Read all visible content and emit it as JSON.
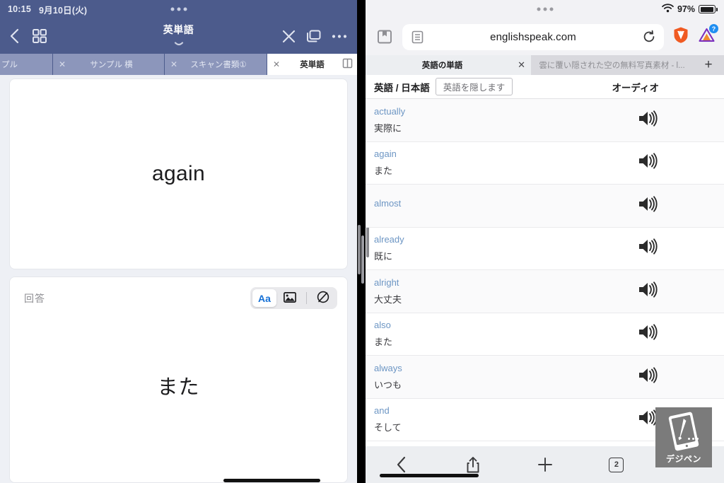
{
  "left": {
    "status": {
      "time": "10:15",
      "date": "9月10日(火)"
    },
    "nav": {
      "back_icon": "chevron-left-icon",
      "grid_icon": "grid-icon",
      "title": "英単語",
      "close_icon": "close-icon",
      "duplicate_icon": "copy-icon",
      "more_icon": "more-horizontal-icon"
    },
    "tabs": [
      {
        "label": "プル",
        "close": "✕",
        "active": false
      },
      {
        "label": "サンプル 横",
        "close": "✕",
        "active": false
      },
      {
        "label": "スキャン書類①",
        "close": "✕",
        "active": false
      },
      {
        "label": "英単語",
        "close": "✕",
        "active": true
      }
    ],
    "question_card": {
      "word": "again"
    },
    "answer_card": {
      "label": "回答",
      "word": "また",
      "tools": [
        {
          "name": "text-tool",
          "label": "Aa",
          "selected": true
        },
        {
          "name": "image-tool",
          "label": "",
          "selected": false
        },
        {
          "name": "draw-tool",
          "label": "",
          "selected": false
        }
      ]
    }
  },
  "right": {
    "status": {
      "wifi": "wifi-icon",
      "battery_percent": "97%"
    },
    "urlbar": {
      "bookmark_icon": "bookmarks-icon",
      "reader_icon": "reader-mode-icon",
      "url": "englishspeak.com",
      "reload_icon": "reload-icon",
      "brave_icon": "brave-lion-icon",
      "extension_icon": "triangle-extension-icon",
      "extension_badge": "?"
    },
    "tabs": [
      {
        "label": "英語の単語",
        "close": "✕",
        "active": true
      },
      {
        "label": "雲に覆い隠された空の無料写真素材 - l...",
        "close": "",
        "active": false
      }
    ],
    "new_tab_label": "+",
    "table": {
      "col_words": "英語 / 日本語",
      "hide_button": "英語を隠します",
      "col_audio": "オーディオ",
      "rows": [
        {
          "en": "actually",
          "ja": "実際に"
        },
        {
          "en": "again",
          "ja": "また"
        },
        {
          "en": "almost",
          "ja": ""
        },
        {
          "en": "already",
          "ja": "既に"
        },
        {
          "en": "alright",
          "ja": "大丈夫"
        },
        {
          "en": "also",
          "ja": "また"
        },
        {
          "en": "always",
          "ja": "いつも"
        },
        {
          "en": "and",
          "ja": "そして"
        }
      ]
    },
    "bottombar": {
      "back_icon": "chevron-left-icon",
      "share_icon": "share-icon",
      "new_tab_icon": "plus-icon",
      "tab_count": "2"
    }
  },
  "watermark": {
    "text": "デジペン",
    "icon": "tablet-pen-icon"
  },
  "colors": {
    "left_chrome": "#4c5b8c",
    "left_tab_inactive": "#8c96bb",
    "accent_blue": "#1570d6",
    "word_link": "#6d96c4",
    "browser_chrome": "#f2f2f5"
  }
}
